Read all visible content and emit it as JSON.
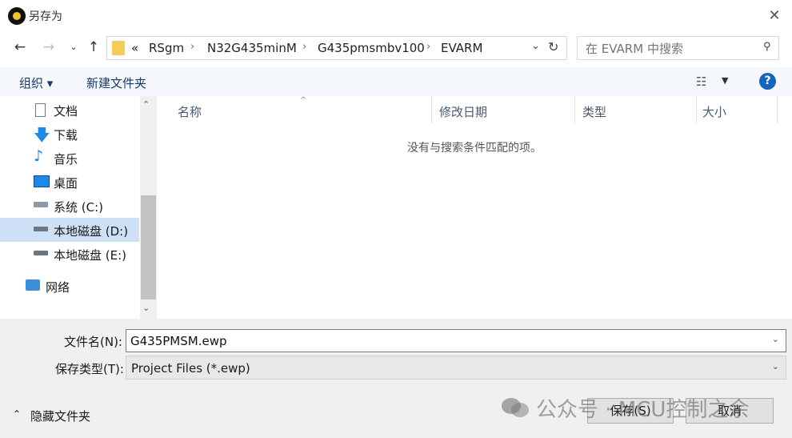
{
  "window": {
    "title": "另存为"
  },
  "address": {
    "overflow": "«",
    "crumbs": [
      "RSgm",
      "N32G435minM",
      "G435pmsmbv100",
      "EVARM"
    ]
  },
  "search": {
    "placeholder": "在 EVARM 中搜索"
  },
  "toolbar": {
    "organize": "组织 ▾",
    "new_folder": "新建文件夹"
  },
  "sidebar": {
    "items": [
      {
        "label": "文档"
      },
      {
        "label": "下载"
      },
      {
        "label": "音乐"
      },
      {
        "label": "桌面"
      },
      {
        "label": "系统 (C:)"
      },
      {
        "label": "本地磁盘 (D:)"
      },
      {
        "label": "本地磁盘 (E:)"
      },
      {
        "label": "网络"
      }
    ]
  },
  "columns": [
    "名称",
    "修改日期",
    "类型",
    "大小"
  ],
  "empty_message": "没有与搜索条件匹配的项。",
  "form": {
    "filename_label": "文件名(N):",
    "filename_value": "G435PMSM.ewp",
    "type_label": "保存类型(T):",
    "type_value": "Project Files (*.ewp)"
  },
  "footer": {
    "hide_folders": "隐藏文件夹",
    "save": "保存(S)",
    "cancel": "取消",
    "watermark": "公众号 · MCU控制之余"
  },
  "colors": {
    "accent": "#1565c0",
    "selected_bg": "#cde0f6",
    "folder": "#f5cc56"
  }
}
